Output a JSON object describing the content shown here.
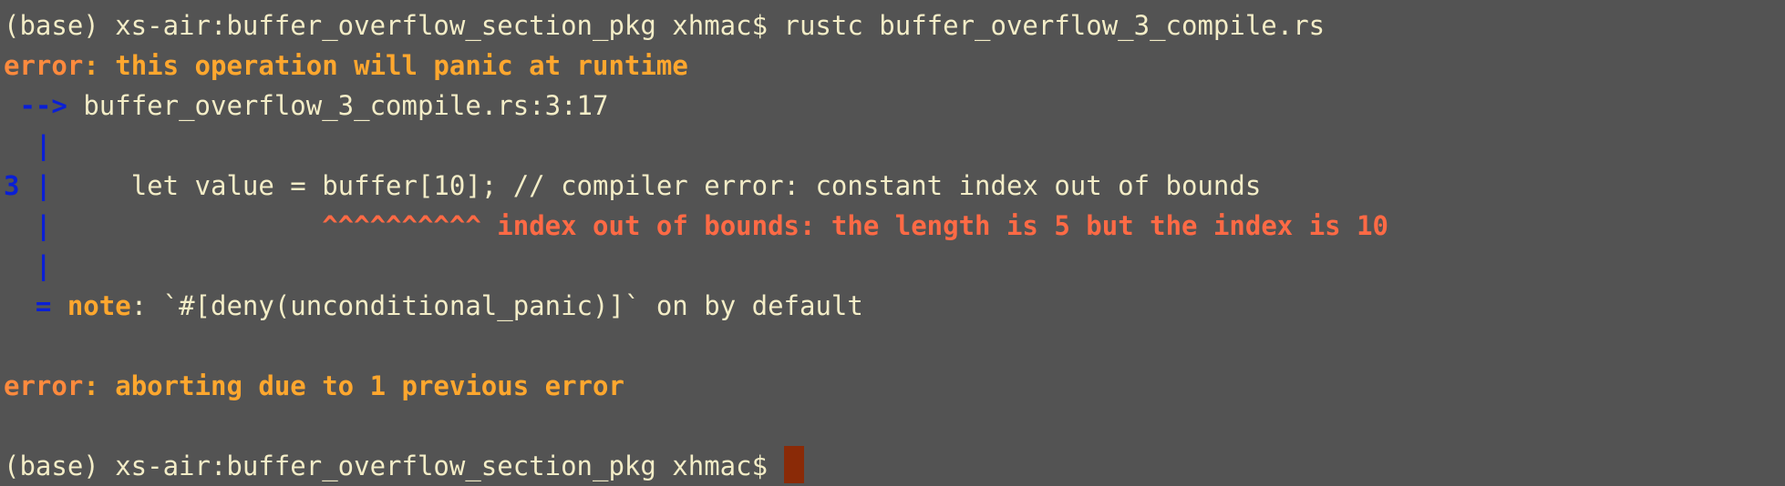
{
  "terminal": {
    "colors": {
      "background": "#535353",
      "text": "#f3edc7",
      "error_label": "#ff8a3d",
      "error_text": "#ffa72e",
      "gutter": "#0a1fd6",
      "annotation": "#ff6a45",
      "cursor": "#8a2a07"
    },
    "lines": {
      "command_prompt": "(base) xs-air:buffer_overflow_section_pkg xhmac$ ",
      "command": "rustc buffer_overflow_3_compile.rs",
      "error1_label": "error",
      "error1_message": ": this operation will panic at runtime",
      "location_arrow": " --> ",
      "location": "buffer_overflow_3_compile.rs:3:17",
      "gutter_bar_1": "  |",
      "line_number": "3",
      "gutter_bar_2": " |",
      "code": "     let value = buffer[10]; // compiler error: constant index out of bounds",
      "gutter_bar_3": "  |",
      "carets_pad": "                 ",
      "carets": "^^^^^^^^^^",
      "annotation": " index out of bounds: the length is 5 but the index is 10",
      "gutter_bar_4": "  |",
      "note_eq": "  = ",
      "note_label": "note",
      "note_text": ": `#[deny(unconditional_panic)]` on by default",
      "error2_label": "error",
      "error2_message": ": aborting due to 1 previous error",
      "final_prompt": "(base) xs-air:buffer_overflow_section_pkg xhmac$ "
    }
  }
}
